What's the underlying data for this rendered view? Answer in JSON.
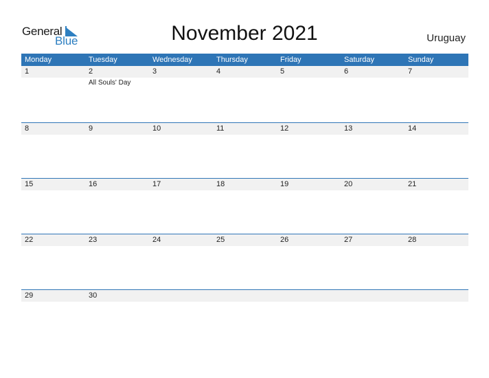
{
  "logo": {
    "part1": "General",
    "part2": "Blue"
  },
  "title": "November 2021",
  "country": "Uruguay",
  "colors": {
    "header_bg": "#2e75b6",
    "date_strip": "#f1f1f1",
    "accent": "#2d7fc1"
  },
  "weekdays": [
    "Monday",
    "Tuesday",
    "Wednesday",
    "Thursday",
    "Friday",
    "Saturday",
    "Sunday"
  ],
  "weeks": [
    {
      "days": [
        {
          "num": "1",
          "event": ""
        },
        {
          "num": "2",
          "event": "All Souls' Day"
        },
        {
          "num": "3",
          "event": ""
        },
        {
          "num": "4",
          "event": ""
        },
        {
          "num": "5",
          "event": ""
        },
        {
          "num": "6",
          "event": ""
        },
        {
          "num": "7",
          "event": ""
        }
      ]
    },
    {
      "days": [
        {
          "num": "8",
          "event": ""
        },
        {
          "num": "9",
          "event": ""
        },
        {
          "num": "10",
          "event": ""
        },
        {
          "num": "11",
          "event": ""
        },
        {
          "num": "12",
          "event": ""
        },
        {
          "num": "13",
          "event": ""
        },
        {
          "num": "14",
          "event": ""
        }
      ]
    },
    {
      "days": [
        {
          "num": "15",
          "event": ""
        },
        {
          "num": "16",
          "event": ""
        },
        {
          "num": "17",
          "event": ""
        },
        {
          "num": "18",
          "event": ""
        },
        {
          "num": "19",
          "event": ""
        },
        {
          "num": "20",
          "event": ""
        },
        {
          "num": "21",
          "event": ""
        }
      ]
    },
    {
      "days": [
        {
          "num": "22",
          "event": ""
        },
        {
          "num": "23",
          "event": ""
        },
        {
          "num": "24",
          "event": ""
        },
        {
          "num": "25",
          "event": ""
        },
        {
          "num": "26",
          "event": ""
        },
        {
          "num": "27",
          "event": ""
        },
        {
          "num": "28",
          "event": ""
        }
      ]
    },
    {
      "days": [
        {
          "num": "29",
          "event": ""
        },
        {
          "num": "30",
          "event": ""
        },
        {
          "num": "",
          "event": ""
        },
        {
          "num": "",
          "event": ""
        },
        {
          "num": "",
          "event": ""
        },
        {
          "num": "",
          "event": ""
        },
        {
          "num": "",
          "event": ""
        }
      ]
    }
  ]
}
